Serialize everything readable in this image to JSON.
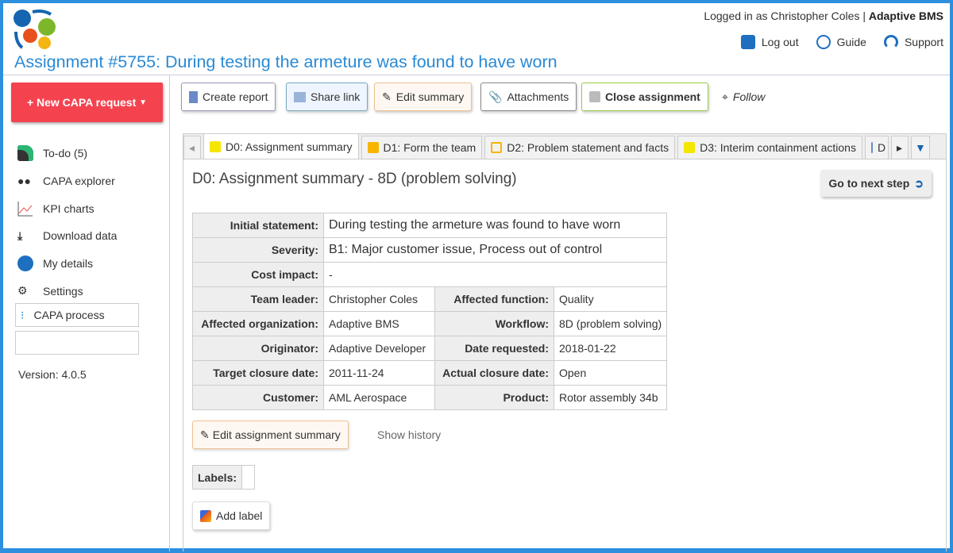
{
  "header": {
    "logged_in": "Logged in as Christopher Coles |",
    "company": "Adaptive BMS",
    "logout": "Log out",
    "guide": "Guide",
    "support": "Support",
    "title": "Assignment #5755: During testing the armeture was found to have worn"
  },
  "sidebar": {
    "new_request": "+ New CAPA request",
    "items": [
      {
        "label": "To-do (5)"
      },
      {
        "label": "CAPA explorer"
      },
      {
        "label": "KPI charts"
      },
      {
        "label": "Download data"
      },
      {
        "label": "My details"
      },
      {
        "label": "Settings"
      }
    ],
    "capa_process": "CAPA process",
    "version": "Version: 4.0.5"
  },
  "toolbar": {
    "create_report": "Create report",
    "share_link": "Share link",
    "edit_summary": "Edit summary",
    "attachments": "Attachments",
    "close_assignment": "Close assignment",
    "follow": "Follow"
  },
  "tabs": [
    {
      "label": "D0: Assignment summary"
    },
    {
      "label": "D1: Form the team"
    },
    {
      "label": "D2: Problem statement and facts"
    },
    {
      "label": "D3: Interim containment actions"
    },
    {
      "label": "D"
    }
  ],
  "main": {
    "heading": "D0: Assignment summary - 8D (problem solving)",
    "next_step": "Go to next step",
    "summary": {
      "initial_statement_label": "Initial statement:",
      "initial_statement": "During testing the armeture was found to have worn",
      "severity_label": "Severity:",
      "severity": "B1: Major customer issue, Process out of control",
      "cost_label": "Cost impact:",
      "cost": "-",
      "rows": [
        [
          "Team leader:",
          "Christopher Coles",
          "Affected function:",
          "Quality"
        ],
        [
          "Affected organization:",
          "Adaptive BMS",
          "Workflow:",
          "8D (problem solving)"
        ],
        [
          "Originator:",
          "Adaptive Developer",
          "Date requested:",
          "2018-01-22"
        ],
        [
          "Target closure date:",
          "2011-11-24",
          "Actual closure date:",
          "Open"
        ],
        [
          "Customer:",
          "AML Aerospace",
          "Product:",
          "Rotor assembly 34b"
        ]
      ]
    },
    "edit_assignment_summary": "Edit assignment summary",
    "show_history": "Show history",
    "labels_label": "Labels:",
    "add_label": "Add label"
  }
}
